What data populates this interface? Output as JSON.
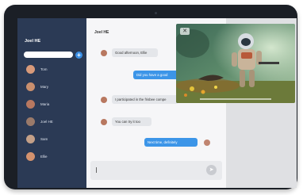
{
  "sidebar": {
    "title": "Joel HE",
    "search_placeholder": "",
    "add_label": "+",
    "contacts": [
      {
        "name": "Tom",
        "avatar_color": "#d89a7a"
      },
      {
        "name": "Mary",
        "avatar_color": "#c98f6e"
      },
      {
        "name": "Maria",
        "avatar_color": "#b87860"
      },
      {
        "name": "Joel HE",
        "avatar_color": "#9a7a6a"
      },
      {
        "name": "Sam",
        "avatar_color": "#c4a088"
      },
      {
        "name": "Ellie",
        "avatar_color": "#d4926e"
      }
    ]
  },
  "chat": {
    "title": "Joel HE",
    "messages": [
      {
        "text": "Good afternoon, Ellie",
        "direction": "in"
      },
      {
        "text": "Did you have a good",
        "direction": "out"
      },
      {
        "text": "I participated in the frisbee compe",
        "direction": "in"
      },
      {
        "text": "You can try it too",
        "direction": "in"
      },
      {
        "text": "Next time, definitely",
        "direction": "out"
      }
    ],
    "input_value": "",
    "send_icon": "arrow-right-icon"
  },
  "video": {
    "close_icon": "close-icon",
    "close_label": "✕"
  },
  "colors": {
    "sidebar": "#2b3a55",
    "outgoing_bubble": "#3c95e8",
    "incoming_bubble": "#e4e6ea",
    "accent": "#3a8fe6"
  }
}
